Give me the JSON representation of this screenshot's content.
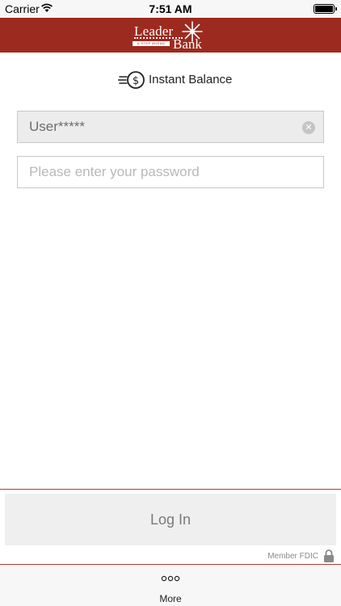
{
  "status_bar": {
    "carrier": "Carrier",
    "time": "7:51 AM"
  },
  "header": {
    "logo": {
      "line1": "Leader",
      "line2": "Bank",
      "tagline": "A STEP AHEAD"
    },
    "brand_color": "#9c2a1f"
  },
  "instant_balance": {
    "label": "Instant Balance",
    "icon": "dollar-coin-speed-icon"
  },
  "username_field": {
    "value": "User*****"
  },
  "password_field": {
    "placeholder": "Please enter your password"
  },
  "login_button": {
    "label": "Log In"
  },
  "footer": {
    "member_text": "Member FDIC",
    "icon": "lock-icon"
  },
  "tab_bar": {
    "more_label": "More",
    "icon": "more-dots-icon"
  }
}
